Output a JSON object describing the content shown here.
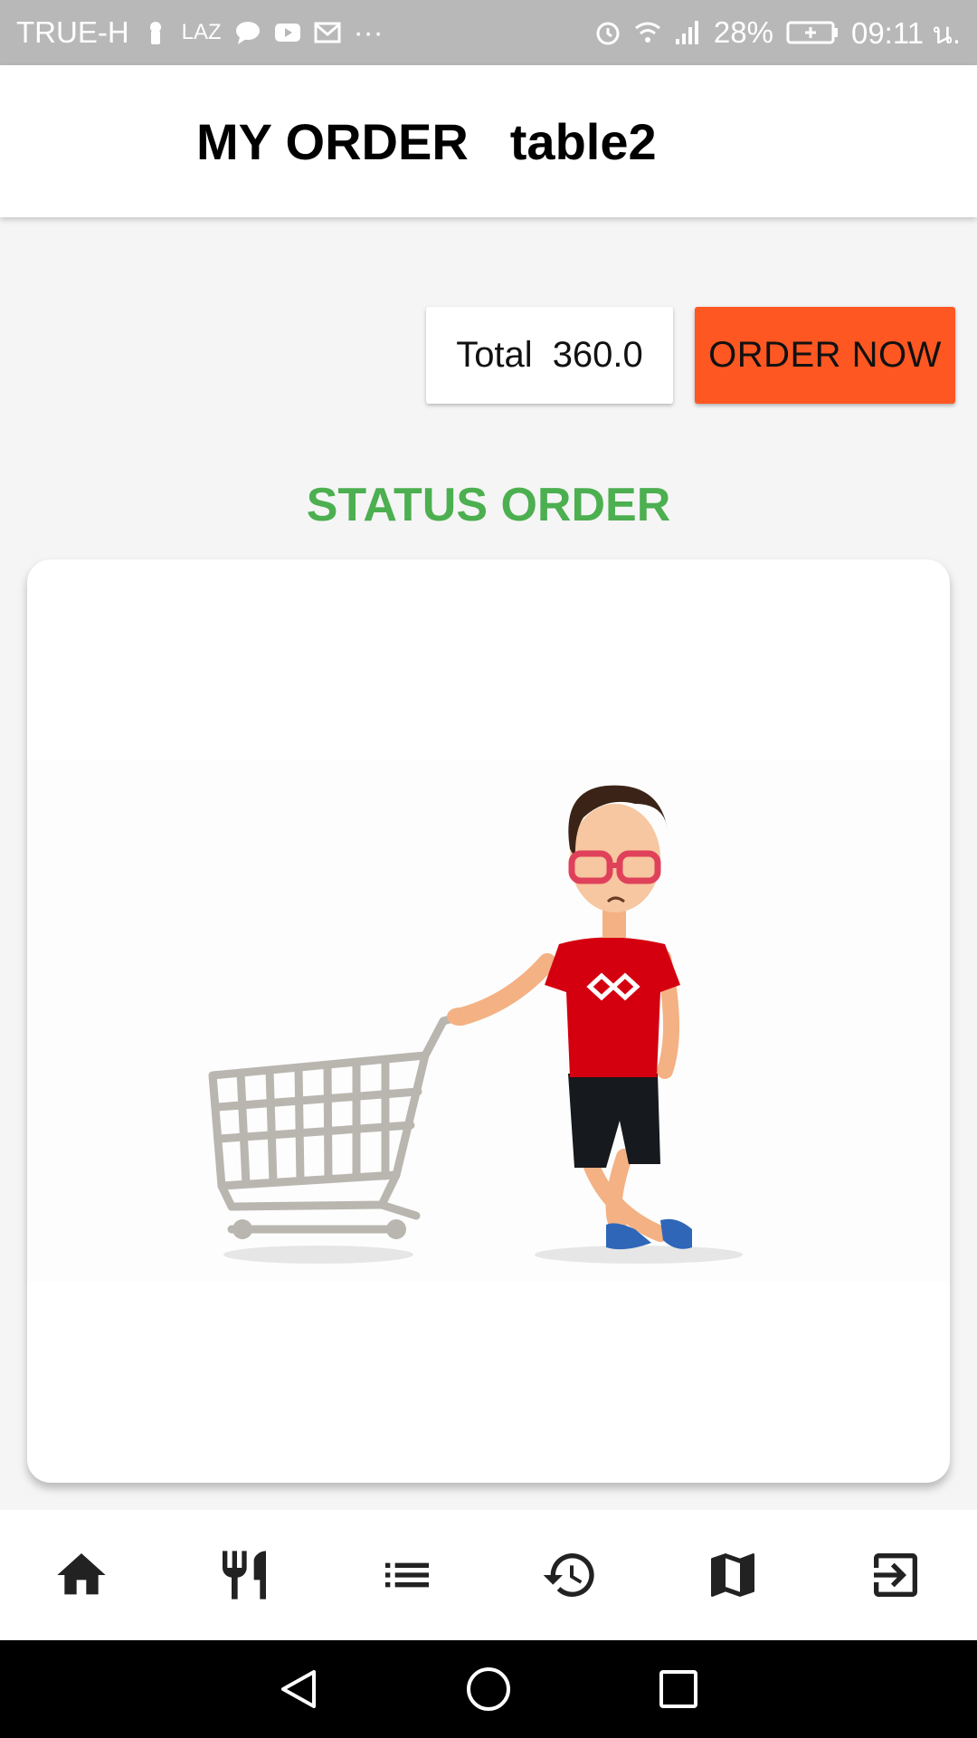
{
  "status_bar": {
    "carrier": "TRUE-H",
    "app_badge": "LAZ",
    "more": "···",
    "battery": "28%",
    "time": "09:11 น."
  },
  "header": {
    "title": "MY ORDER",
    "table": "table2"
  },
  "order": {
    "total_label": "Total",
    "total_value": "360.0",
    "order_button": "ORDER NOW"
  },
  "status": {
    "title": "STATUS ORDER",
    "illustration": "empty-cart-illustration",
    "title_color": "#4caf50"
  },
  "colors": {
    "accent": "#ff5722",
    "status_bar": "#b8b8b8"
  },
  "bottom_nav": {
    "items": [
      {
        "icon": "home-icon"
      },
      {
        "icon": "restaurant-menu-icon"
      },
      {
        "icon": "list-icon"
      },
      {
        "icon": "history-icon"
      },
      {
        "icon": "map-icon"
      },
      {
        "icon": "exit-icon"
      }
    ]
  },
  "system_nav": {
    "items": [
      {
        "icon": "back-icon"
      },
      {
        "icon": "home-circle-icon"
      },
      {
        "icon": "recents-icon"
      }
    ]
  }
}
